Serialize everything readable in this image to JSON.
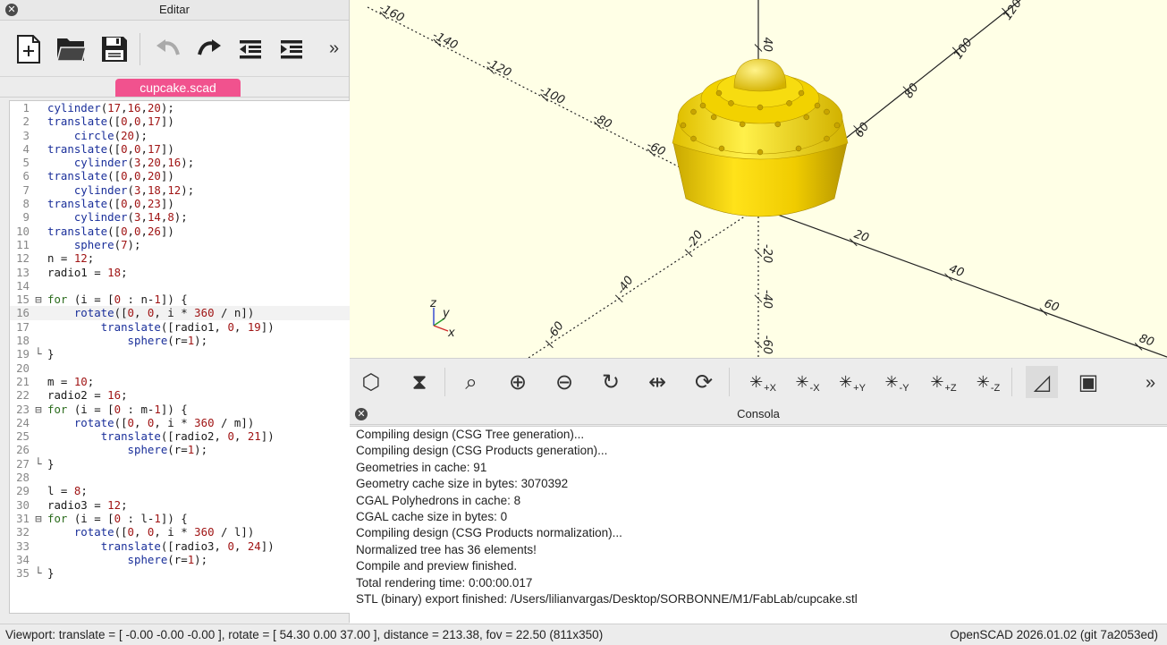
{
  "editor": {
    "title": "Editar",
    "tab_label": "cupcake.scad",
    "more": "»",
    "toolbar_icons": [
      "new-file-icon",
      "open-file-icon",
      "save-file-icon",
      "undo-icon",
      "redo-icon",
      "unindent-icon",
      "indent-icon"
    ],
    "lines": [
      {
        "n": "1",
        "fold": "",
        "text": "cylinder(17,16,20);"
      },
      {
        "n": "2",
        "fold": "",
        "text": "translate([0,0,17])"
      },
      {
        "n": "3",
        "fold": "",
        "text": "    circle(20);"
      },
      {
        "n": "4",
        "fold": "",
        "text": "translate([0,0,17])"
      },
      {
        "n": "5",
        "fold": "",
        "text": "    cylinder(3,20,16);"
      },
      {
        "n": "6",
        "fold": "",
        "text": "translate([0,0,20])"
      },
      {
        "n": "7",
        "fold": "",
        "text": "    cylinder(3,18,12);"
      },
      {
        "n": "8",
        "fold": "",
        "text": "translate([0,0,23])"
      },
      {
        "n": "9",
        "fold": "",
        "text": "    cylinder(3,14,8);"
      },
      {
        "n": "10",
        "fold": "",
        "text": "translate([0,0,26])"
      },
      {
        "n": "11",
        "fold": "",
        "text": "    sphere(7);"
      },
      {
        "n": "12",
        "fold": "",
        "text": "n = 12;"
      },
      {
        "n": "13",
        "fold": "",
        "text": "radio1 = 18;"
      },
      {
        "n": "14",
        "fold": "",
        "text": ""
      },
      {
        "n": "15",
        "fold": "⊟",
        "text": "for (i = [0 : n-1]) {"
      },
      {
        "n": "16",
        "fold": "",
        "text": "    rotate([0, 0, i * 360 / n])"
      },
      {
        "n": "17",
        "fold": "",
        "text": "        translate([radio1, 0, 19])"
      },
      {
        "n": "18",
        "fold": "",
        "text": "            sphere(r=1);"
      },
      {
        "n": "19",
        "fold": "└",
        "text": "}"
      },
      {
        "n": "20",
        "fold": "",
        "text": ""
      },
      {
        "n": "21",
        "fold": "",
        "text": "m = 10;"
      },
      {
        "n": "22",
        "fold": "",
        "text": "radio2 = 16;"
      },
      {
        "n": "23",
        "fold": "⊟",
        "text": "for (i = [0 : m-1]) {"
      },
      {
        "n": "24",
        "fold": "",
        "text": "    rotate([0, 0, i * 360 / m])"
      },
      {
        "n": "25",
        "fold": "",
        "text": "        translate([radio2, 0, 21])"
      },
      {
        "n": "26",
        "fold": "",
        "text": "            sphere(r=1);"
      },
      {
        "n": "27",
        "fold": "└",
        "text": "}"
      },
      {
        "n": "28",
        "fold": "",
        "text": ""
      },
      {
        "n": "29",
        "fold": "",
        "text": "l = 8;"
      },
      {
        "n": "30",
        "fold": "",
        "text": "radio3 = 12;"
      },
      {
        "n": "31",
        "fold": "⊟",
        "text": "for (i = [0 : l-1]) {"
      },
      {
        "n": "32",
        "fold": "",
        "text": "    rotate([0, 0, i * 360 / l])"
      },
      {
        "n": "33",
        "fold": "",
        "text": "        translate([radio3, 0, 24])"
      },
      {
        "n": "34",
        "fold": "",
        "text": "            sphere(r=1);"
      },
      {
        "n": "35",
        "fold": "└",
        "text": "}"
      }
    ]
  },
  "viewport": {
    "axis_labels": {
      "neg_x": [
        "-160",
        "-140",
        "-120",
        "-100",
        "-80",
        "-60",
        "-40"
      ],
      "pos_x": [
        "20",
        "40",
        "60",
        "80"
      ],
      "neg_y": [
        "-20",
        "-40",
        "-60"
      ],
      "pos_y": [
        "40",
        "60",
        "80",
        "100",
        "120"
      ],
      "pos_z": [
        "40"
      ],
      "neg_z": [
        "-20",
        "-40",
        "-60"
      ]
    },
    "small_axes": {
      "z": "z",
      "y": "y",
      "x": "x"
    },
    "object_color": "#f5d800"
  },
  "view_toolbar": {
    "more": "»",
    "buttons": [
      {
        "name": "preview-icon",
        "label": ""
      },
      {
        "name": "render-icon",
        "label": ""
      },
      {
        "name": "view-all-icon",
        "label": ""
      },
      {
        "name": "zoom-in-icon",
        "label": ""
      },
      {
        "name": "zoom-out-icon",
        "label": ""
      },
      {
        "name": "reset-view-icon",
        "label": ""
      },
      {
        "name": "orthogonal-icon",
        "label": ""
      },
      {
        "name": "rotate-45-icon",
        "label": ""
      },
      {
        "name": "view-right-icon",
        "label": "+X"
      },
      {
        "name": "view-left-icon",
        "label": "-X"
      },
      {
        "name": "view-back-icon",
        "label": "+Y"
      },
      {
        "name": "view-front-icon",
        "label": "-Y"
      },
      {
        "name": "view-top-icon",
        "label": "+Z"
      },
      {
        "name": "view-bottom-icon",
        "label": "-Z"
      },
      {
        "name": "perspective-icon",
        "label": ""
      },
      {
        "name": "orthographic-icon",
        "label": ""
      }
    ]
  },
  "console": {
    "title": "Consola",
    "lines": [
      "Compiling design (CSG Tree generation)...",
      "Compiling design (CSG Products generation)...",
      "Geometries in cache: 91",
      "Geometry cache size in bytes: 3070392",
      "CGAL Polyhedrons in cache: 8",
      "CGAL cache size in bytes: 0",
      "Compiling design (CSG Products normalization)...",
      "Normalized tree has 36 elements!",
      "Compile and preview finished.",
      "Total rendering time: 0:00:00.017",
      "STL (binary) export finished: /Users/lilianvargas/Desktop/SORBONNE/M1/FabLab/cupcake.stl"
    ]
  },
  "status": {
    "viewport_info": "Viewport: translate = [ -0.00 -0.00 -0.00 ], rotate = [ 54.30 0.00 37.00 ], distance = 213.38, fov = 22.50 (811x350)",
    "version": "OpenSCAD 2026.01.02 (git 7a2053ed)"
  }
}
